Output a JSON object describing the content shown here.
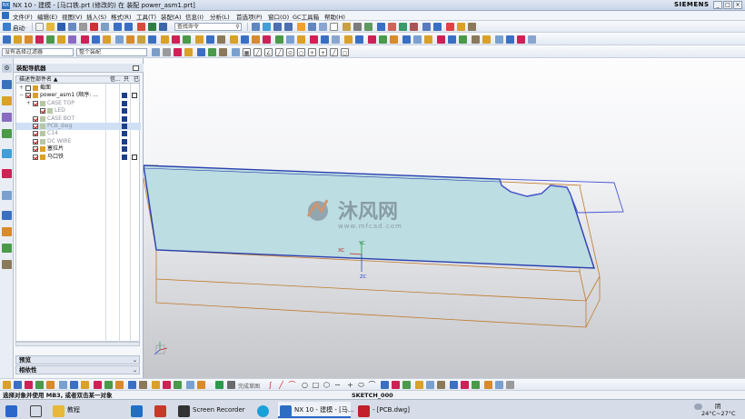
{
  "window": {
    "title": "NX 10 - 建模 - [马口铁.prt  (修改的)  在 装配 power_asm1.prt]",
    "brand": "SIEMENS",
    "controls": [
      "_",
      "□",
      "×"
    ]
  },
  "menu": [
    "文件(F)",
    "编辑(E)",
    "视图(V)",
    "插入(S)",
    "格式(R)",
    "工具(T)",
    "装配(A)",
    "信息(I)",
    "分析(L)",
    "首选项(P)",
    "窗口(O)",
    "GC工具箱",
    "帮助(H)"
  ],
  "toolbar": {
    "start_label": "启动·",
    "search_placeholder": "查找命令",
    "filter_select": "没有选择过滤器",
    "scope_select": "整个装配"
  },
  "navigator": {
    "title": "装配导航器",
    "columns": [
      "描述性部件名 ▲",
      "信...",
      "只",
      "已"
    ],
    "tree": [
      {
        "label": "截面",
        "indent": 0,
        "expander": "+",
        "checked": false,
        "markers": [
          false,
          false
        ],
        "dim": false
      },
      {
        "label": "power_asm1 (顺序: ...",
        "indent": 0,
        "expander": "−",
        "checked": true,
        "markers": [
          true,
          true
        ],
        "dim": false
      },
      {
        "label": "CASE TOP",
        "indent": 1,
        "expander": "+",
        "checked": true,
        "markers": [
          true,
          false
        ],
        "dim": true
      },
      {
        "label": "LED",
        "indent": 2,
        "expander": "",
        "checked": true,
        "markers": [
          true,
          false
        ],
        "dim": true
      },
      {
        "label": "CASE BOT",
        "indent": 1,
        "expander": "",
        "checked": true,
        "markers": [
          true,
          false
        ],
        "dim": true
      },
      {
        "label": "PCB_dwg",
        "indent": 1,
        "expander": "",
        "checked": true,
        "markers": [
          true,
          false
        ],
        "dim": true
      },
      {
        "label": "C14",
        "indent": 1,
        "expander": "",
        "checked": true,
        "markers": [
          true,
          false
        ],
        "dim": true
      },
      {
        "label": "DC WIRE",
        "indent": 1,
        "expander": "",
        "checked": true,
        "markers": [
          true,
          false
        ],
        "dim": true
      },
      {
        "label": "塞拉片",
        "indent": 1,
        "expander": "",
        "checked": true,
        "markers": [
          true,
          false
        ],
        "dim": false
      },
      {
        "label": "马口铁",
        "indent": 1,
        "expander": "",
        "checked": true,
        "markers": [
          true,
          true
        ],
        "dim": false
      }
    ],
    "panels": [
      "预览",
      "相依性"
    ]
  },
  "viewport": {
    "watermark_text": "沐风网",
    "watermark_url": "www.mfcad.com",
    "axis_labels": {
      "xc": "XC",
      "yc": "YC",
      "zc": "ZC"
    }
  },
  "bottom_toolbar": {
    "finish_label": "完成草图"
  },
  "status": {
    "prompt": "选择对象并使用 MB3, 或者双击某一对象",
    "sketch_name": "SKETCH_000"
  },
  "taskbar": {
    "items": [
      "教程",
      "Screen Recorder",
      "NX 10 - 建模 - [马...",
      "- [PCB.dwg]"
    ],
    "weather_label": "阴",
    "weather_temp": "24°C~27°C"
  },
  "colors": {
    "plate_fill": "#bcdde1",
    "plate_edge": "#2a3fb0",
    "box_edge": "#c07a2a",
    "selected_row": "#cfe0f5"
  }
}
